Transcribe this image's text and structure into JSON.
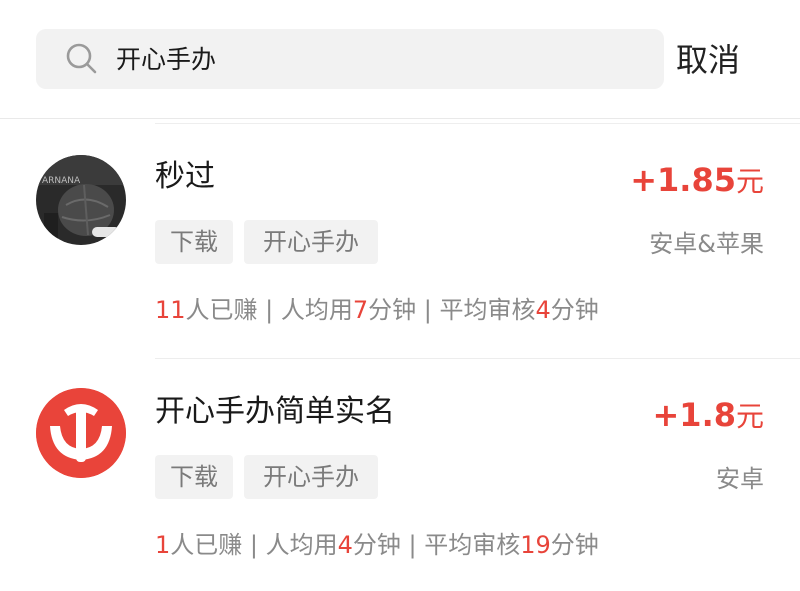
{
  "search": {
    "query": "开心手办",
    "cancel_label": "取消"
  },
  "items": [
    {
      "title": "秒过",
      "price": "+1.85",
      "price_unit": "元",
      "tags": [
        "下载",
        "开心手办"
      ],
      "platform": "安卓&苹果",
      "stats": {
        "earned_count": "11",
        "earned_label": "人已赚",
        "sep1": " | ",
        "avg_label": "人均用",
        "avg_time": "7",
        "avg_unit": "分钟",
        "sep2": " | ",
        "review_label": "平均审核",
        "review_time": "4",
        "review_unit": "分钟"
      }
    },
    {
      "title": "开心手办简单实名",
      "price": "+1.8",
      "price_unit": "元",
      "tags": [
        "下载",
        "开心手办"
      ],
      "platform": "安卓",
      "stats": {
        "earned_count": "1",
        "earned_label": "人已赚",
        "sep1": " | ",
        "avg_label": "人均用",
        "avg_time": "4",
        "avg_unit": "分钟",
        "sep2": " | ",
        "review_label": "平均审核",
        "review_time": "19",
        "review_unit": "分钟"
      }
    }
  ],
  "colors": {
    "accent": "#e8443a",
    "muted": "#8a8a8a",
    "tag_bg": "#f2f2f2",
    "logo_red": "#e9443a"
  },
  "icons": {
    "search": "search-icon",
    "item1_avatar": "photo-avatar",
    "item2_avatar": "red-logo-avatar"
  }
}
